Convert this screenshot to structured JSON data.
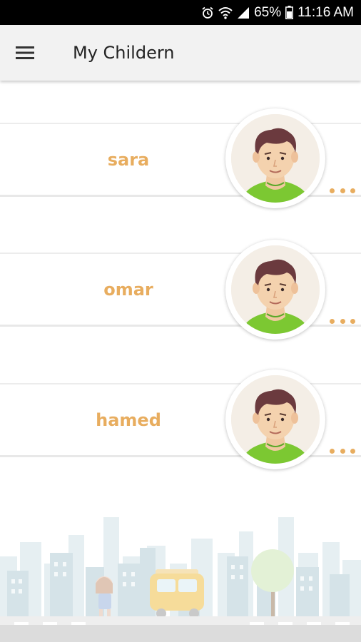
{
  "status_bar": {
    "battery": "65%",
    "time": "11:16 AM",
    "icons": [
      "alarm-icon",
      "wifi-icon",
      "signal-icon",
      "battery-icon"
    ]
  },
  "app_bar": {
    "title": "My Childern",
    "menu_icon": "hamburger-menu-icon"
  },
  "children": [
    {
      "name": "sara",
      "avatar": "boy-avatar-icon",
      "more_icon": "more-dots-icon"
    },
    {
      "name": "omar",
      "avatar": "boy-avatar-icon",
      "more_icon": "more-dots-icon"
    },
    {
      "name": "hamed",
      "avatar": "boy-avatar-icon",
      "more_icon": "more-dots-icon"
    }
  ],
  "colors": {
    "accent": "#e8ad5f",
    "app_bar_bg": "#f2f2f2",
    "status_bar_bg": "#000000",
    "avatar_shirt": "#7cc832",
    "avatar_hair": "#6b3a3e"
  }
}
